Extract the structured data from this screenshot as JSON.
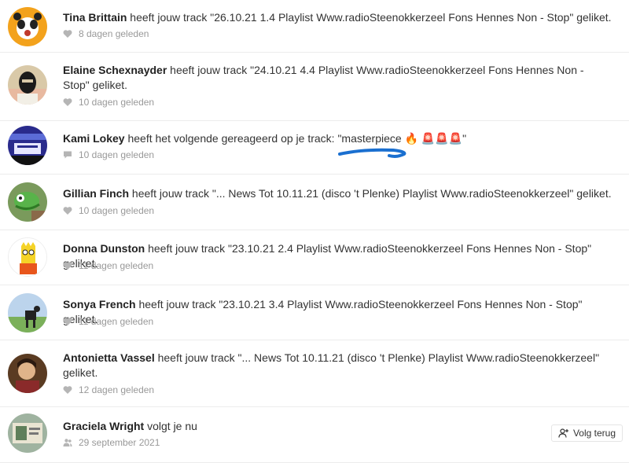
{
  "notifications": [
    {
      "name": "Tina Brittain",
      "text": " heeft jouw track \"26.10.21 1.4 Playlist Www.radioSteenokkerzeel Fons Hennes Non - Stop\" geliket.",
      "time": "8 dagen geleden",
      "meta_icon": "heart-icon"
    },
    {
      "name": "Elaine Schexnayder",
      "text": " heeft jouw track \"24.10.21 4.4 Playlist Www.radioSteenokkerzeel Fons Hennes Non - Stop\" geliket.",
      "time": "10 dagen geleden",
      "meta_icon": "heart-icon"
    },
    {
      "name": "Kami Lokey",
      "text": " heeft het volgende gereageerd op je track: \"masterpiece 🔥 🚨🚨🚨\"",
      "time": "10 dagen geleden",
      "meta_icon": "comment-icon"
    },
    {
      "name": "Gillian Finch",
      "text": " heeft jouw track \"... News Tot 10.11.21 (disco 't Plenke) Playlist Www.radioSteenokkerzeel\" geliket.",
      "time": "10 dagen geleden",
      "meta_icon": "heart-icon"
    },
    {
      "name": "Donna Dunston",
      "text": " heeft jouw track \"23.10.21 2.4 Playlist Www.radioSteenokkerzeel Fons Hennes Non - Stop\" geliket.",
      "time": "11 dagen geleden",
      "meta_icon": "heart-icon"
    },
    {
      "name": "Sonya French",
      "text": " heeft jouw track \"23.10.21 3.4 Playlist Www.radioSteenokkerzeel Fons Hennes Non - Stop\" geliket.",
      "time": "11 dagen geleden",
      "meta_icon": "heart-icon"
    },
    {
      "name": "Antonietta Vassel",
      "text": " heeft jouw track \"... News Tot 10.11.21 (disco 't Plenke) Playlist Www.radioSteenokkerzeel\" geliket.",
      "time": "12 dagen geleden",
      "meta_icon": "heart-icon"
    },
    {
      "name": "Graciela Wright",
      "text": " volgt je nu",
      "time": "29 september 2021",
      "meta_icon": "user-icon"
    }
  ],
  "follow_back_label": "Volg terug",
  "colors": {
    "annotation_scribble": "#1a6fd0",
    "meta_icon": "#b5b5b5"
  }
}
